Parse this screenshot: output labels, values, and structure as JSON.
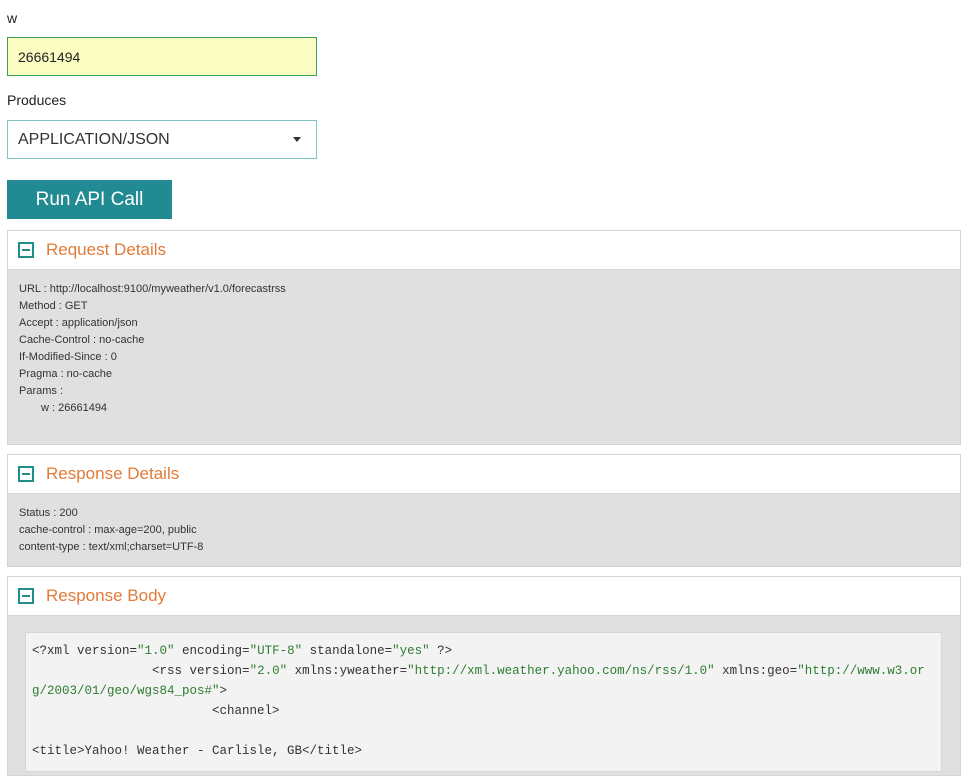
{
  "form": {
    "w_label": "w",
    "w_value": "26661494",
    "produces_label": "Produces",
    "produces_selected": "APPLICATION/JSON",
    "run_button": "Run API Call"
  },
  "request_details": {
    "title": "Request Details",
    "lines": [
      "URL : http://localhost:9100/myweather/v1.0/forecastrss",
      "Method : GET",
      "Accept : application/json",
      "Cache-Control : no-cache",
      "If-Modified-Since : 0",
      "Pragma : no-cache",
      "Params :"
    ],
    "param_line": "w : 26661494"
  },
  "response_details": {
    "title": "Response Details",
    "lines": [
      "Status : 200",
      "cache-control : max-age=200, public",
      "content-type : text/xml;charset=UTF-8"
    ]
  },
  "response_body": {
    "title": "Response Body",
    "xml_decl": {
      "prefix": "<?xml version=",
      "version": "\"1.0\"",
      "enc_attr": " encoding=",
      "encoding": "\"UTF-8\"",
      "sa_attr": " standalone=",
      "standalone": "\"yes\"",
      "suffix": " ?>"
    },
    "rss_line": {
      "indent": "                ",
      "prefix": "<rss version=",
      "version": "\"2.0\"",
      "attr1": " xmlns:yweather=",
      "val1": "\"http://xml.weather.yahoo.com/ns/rss/1.0\"",
      "attr2": " xmlns:geo=",
      "val2": "\"http://www.w3.org/2003/01/geo/wgs84_pos#\"",
      "suffix": ">"
    },
    "channel_line": "                        <channel>",
    "title_line": "<title>Yahoo! Weather - Carlisle, GB</title>"
  }
}
